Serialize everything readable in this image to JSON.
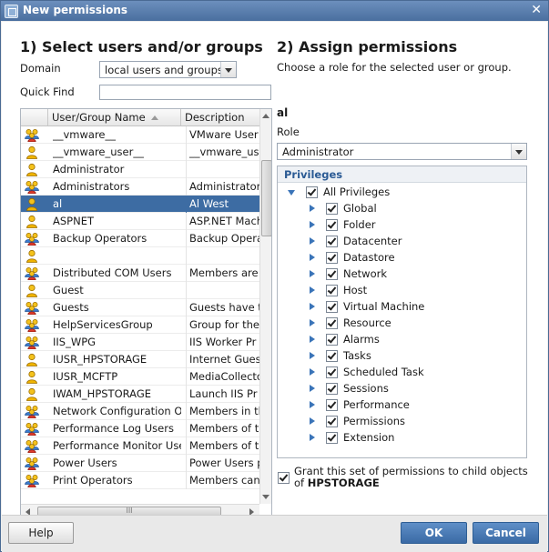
{
  "window": {
    "title": "New permissions"
  },
  "left": {
    "heading": "1) Select users and/or groups",
    "domain_label": "Domain",
    "domain_value": "local users and groups",
    "quickfind_label": "Quick Find",
    "quickfind_value": "",
    "columns": [
      "User/Group Name",
      "Description"
    ],
    "rows": [
      {
        "icon": "group",
        "name": "__vmware__",
        "desc": "VMware User"
      },
      {
        "icon": "user",
        "name": "__vmware_user__",
        "desc": "__vmware_us"
      },
      {
        "icon": "user",
        "name": "Administrator",
        "desc": ""
      },
      {
        "icon": "group",
        "name": "Administrators",
        "desc": "Administrator"
      },
      {
        "icon": "user",
        "name": "al",
        "desc": "Al West",
        "selected": true
      },
      {
        "icon": "user",
        "name": "ASPNET",
        "desc": "ASP.NET Mach"
      },
      {
        "icon": "group",
        "name": "Backup Operators",
        "desc": "Backup Opera"
      },
      {
        "icon": "user",
        "name": "",
        "desc": ""
      },
      {
        "icon": "group",
        "name": "Distributed COM Users",
        "desc": "Members are"
      },
      {
        "icon": "user",
        "name": "Guest",
        "desc": ""
      },
      {
        "icon": "group",
        "name": "Guests",
        "desc": "Guests have t"
      },
      {
        "icon": "group",
        "name": "HelpServicesGroup",
        "desc": "Group for the"
      },
      {
        "icon": "group",
        "name": "IIS_WPG",
        "desc": "IIS Worker Pr"
      },
      {
        "icon": "user",
        "name": "IUSR_HPSTORAGE",
        "desc": "Internet Gues"
      },
      {
        "icon": "user",
        "name": "IUSR_MCFTP",
        "desc": "MediaCollecto"
      },
      {
        "icon": "user",
        "name": "IWAM_HPSTORAGE",
        "desc": "Launch IIS Pr"
      },
      {
        "icon": "group",
        "name": "Network Configuration Op",
        "desc": "Members in th"
      },
      {
        "icon": "group",
        "name": "Performance Log Users",
        "desc": "Members of th"
      },
      {
        "icon": "group",
        "name": "Performance Monitor Use",
        "desc": "Members of th"
      },
      {
        "icon": "group",
        "name": "Power Users",
        "desc": "Power Users p"
      },
      {
        "icon": "group",
        "name": "Print Operators",
        "desc": "Members can"
      }
    ],
    "hscroll_grip": "III"
  },
  "right": {
    "heading": "2) Assign permissions",
    "subtitle": "Choose a role for the selected user or group.",
    "selected_user": "al",
    "role_label": "Role",
    "role_value": "Administrator",
    "privileges_label": "Privileges",
    "root_item": "All Privileges",
    "items": [
      "Global",
      "Folder",
      "Datacenter",
      "Datastore",
      "Network",
      "Host",
      "Virtual Machine",
      "Resource",
      "Alarms",
      "Tasks",
      "Scheduled Task",
      "Sessions",
      "Performance",
      "Permissions",
      "Extension"
    ],
    "propagate_text": "Grant this set of permissions to child objects",
    "propagate_of": "of",
    "propagate_target": "HPSTORAGE"
  },
  "footer": {
    "help": "Help",
    "ok": "OK",
    "cancel": "Cancel"
  },
  "colors": {
    "title_bar": "#4a6f9f",
    "selection": "#3d6ca3",
    "accent_text": "#2a5a94",
    "ok_button": "#3a6aa5"
  }
}
